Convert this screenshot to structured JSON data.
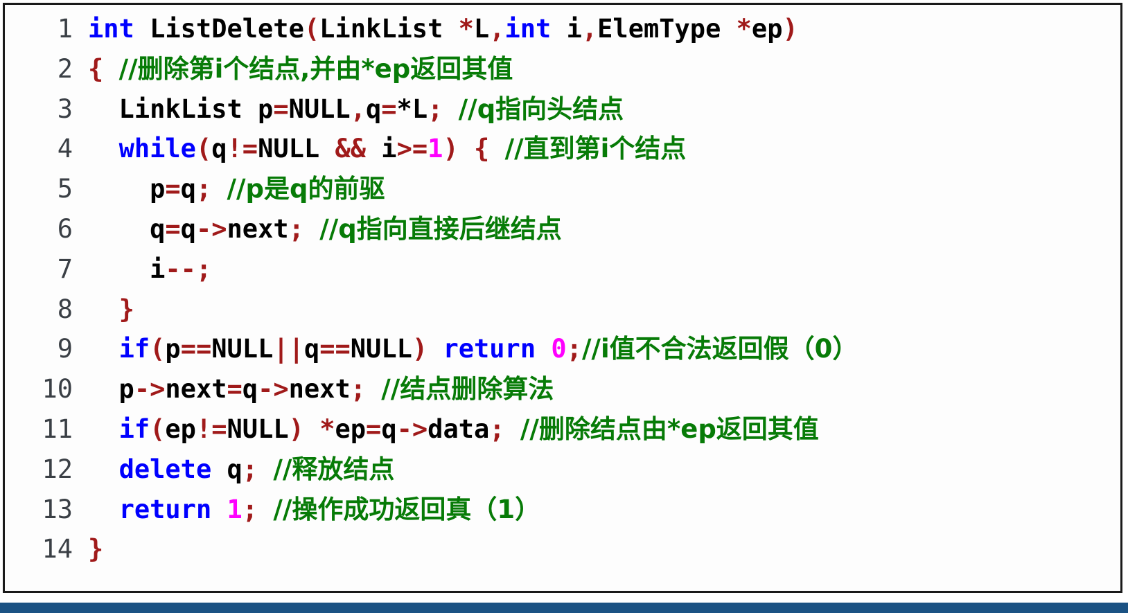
{
  "window": {
    "title": "code-listing",
    "border_color": "#1a1a1a",
    "background": "#fdfdfd",
    "bottom_bar_color": "#1b5283"
  },
  "syntax_colors": {
    "keyword": "#0000ff",
    "identifier": "#000000",
    "punctuation": "#a01a1a",
    "number": "#ff00ff",
    "comment": "#077b07",
    "line_number": "#3a3f45"
  },
  "code": {
    "language": "C++",
    "function_name": "ListDelete",
    "line_count": 14,
    "lines": [
      {
        "number": "1",
        "indent": "",
        "text": "int ListDelete(LinkList *L,int i,ElemType *ep)",
        "tokens": [
          {
            "t": "int",
            "c": "kw"
          },
          {
            "t": " ListDelete",
            "c": "plain"
          },
          {
            "t": "(",
            "c": "punct"
          },
          {
            "t": "LinkList ",
            "c": "plain"
          },
          {
            "t": "*",
            "c": "punct"
          },
          {
            "t": "L",
            "c": "plain"
          },
          {
            "t": ",",
            "c": "punct"
          },
          {
            "t": "int",
            "c": "kw"
          },
          {
            "t": " i",
            "c": "plain"
          },
          {
            "t": ",",
            "c": "punct"
          },
          {
            "t": "ElemType ",
            "c": "plain"
          },
          {
            "t": "*",
            "c": "punct"
          },
          {
            "t": "ep",
            "c": "plain"
          },
          {
            "t": ")",
            "c": "punct"
          }
        ]
      },
      {
        "number": "2",
        "indent": "",
        "text": "{ //删除第i个结点,并由*ep返回其值",
        "tokens": [
          {
            "t": "{",
            "c": "punct"
          },
          {
            "t": " ",
            "c": "plain"
          },
          {
            "t": "//删除第i个结点,并由*ep返回其值",
            "c": "comment"
          }
        ]
      },
      {
        "number": "3",
        "indent": "  ",
        "text": "  LinkList p=NULL,q=*L; //q指向头结点",
        "tokens": [
          {
            "t": "  LinkList p",
            "c": "plain"
          },
          {
            "t": "=",
            "c": "punct"
          },
          {
            "t": "NULL",
            "c": "plain"
          },
          {
            "t": ",",
            "c": "punct"
          },
          {
            "t": "q",
            "c": "plain"
          },
          {
            "t": "=",
            "c": "punct"
          },
          {
            "t": "*",
            "c": "plain"
          },
          {
            "t": "L",
            "c": "plain"
          },
          {
            "t": ";",
            "c": "punct"
          },
          {
            "t": " ",
            "c": "plain"
          },
          {
            "t": "//q指向头结点",
            "c": "comment"
          }
        ]
      },
      {
        "number": "4",
        "indent": "  ",
        "text": "  while(q!=NULL && i>=1) { //直到第i个结点",
        "tokens": [
          {
            "t": "  ",
            "c": "plain"
          },
          {
            "t": "while",
            "c": "kw"
          },
          {
            "t": "(",
            "c": "punct"
          },
          {
            "t": "q",
            "c": "plain"
          },
          {
            "t": "!=",
            "c": "punct"
          },
          {
            "t": "NULL ",
            "c": "plain"
          },
          {
            "t": "&&",
            "c": "punct"
          },
          {
            "t": " i",
            "c": "plain"
          },
          {
            "t": ">=",
            "c": "punct"
          },
          {
            "t": "1",
            "c": "num"
          },
          {
            "t": ")",
            "c": "punct"
          },
          {
            "t": " ",
            "c": "plain"
          },
          {
            "t": "{",
            "c": "punct"
          },
          {
            "t": " ",
            "c": "plain"
          },
          {
            "t": "//直到第i个结点",
            "c": "comment"
          }
        ]
      },
      {
        "number": "5",
        "indent": "    ",
        "text": "    p=q; //p是q的前驱",
        "tokens": [
          {
            "t": "    p",
            "c": "plain"
          },
          {
            "t": "=",
            "c": "punct"
          },
          {
            "t": "q",
            "c": "plain"
          },
          {
            "t": ";",
            "c": "punct"
          },
          {
            "t": " ",
            "c": "plain"
          },
          {
            "t": "//p是q的前驱",
            "c": "comment"
          }
        ]
      },
      {
        "number": "6",
        "indent": "    ",
        "text": "    q=q->next; //q指向直接后继结点",
        "tokens": [
          {
            "t": "    q",
            "c": "plain"
          },
          {
            "t": "=",
            "c": "punct"
          },
          {
            "t": "q",
            "c": "plain"
          },
          {
            "t": "->",
            "c": "punct"
          },
          {
            "t": "next",
            "c": "plain"
          },
          {
            "t": ";",
            "c": "punct"
          },
          {
            "t": " ",
            "c": "plain"
          },
          {
            "t": "//q指向直接后继结点",
            "c": "comment"
          }
        ]
      },
      {
        "number": "7",
        "indent": "    ",
        "text": "    i--;",
        "tokens": [
          {
            "t": "    i",
            "c": "plain"
          },
          {
            "t": "--",
            "c": "punct"
          },
          {
            "t": ";",
            "c": "punct"
          }
        ]
      },
      {
        "number": "8",
        "indent": "  ",
        "text": "  }",
        "tokens": [
          {
            "t": "  ",
            "c": "plain"
          },
          {
            "t": "}",
            "c": "punct"
          }
        ]
      },
      {
        "number": "9",
        "indent": "  ",
        "text": "  if(p==NULL||q==NULL) return 0;//i值不合法返回假（0）",
        "tokens": [
          {
            "t": "  ",
            "c": "plain"
          },
          {
            "t": "if",
            "c": "kw"
          },
          {
            "t": "(",
            "c": "punct"
          },
          {
            "t": "p",
            "c": "plain"
          },
          {
            "t": "==",
            "c": "punct"
          },
          {
            "t": "NULL",
            "c": "plain"
          },
          {
            "t": "||",
            "c": "punct"
          },
          {
            "t": "q",
            "c": "plain"
          },
          {
            "t": "==",
            "c": "punct"
          },
          {
            "t": "NULL",
            "c": "plain"
          },
          {
            "t": ")",
            "c": "punct"
          },
          {
            "t": " ",
            "c": "plain"
          },
          {
            "t": "return",
            "c": "kw"
          },
          {
            "t": " ",
            "c": "plain"
          },
          {
            "t": "0",
            "c": "num"
          },
          {
            "t": ";",
            "c": "punct"
          },
          {
            "t": "//i值不合法返回假（0）",
            "c": "comment"
          }
        ]
      },
      {
        "number": "10",
        "indent": "  ",
        "text": "  p->next=q->next; //结点删除算法",
        "tokens": [
          {
            "t": "  p",
            "c": "plain"
          },
          {
            "t": "->",
            "c": "punct"
          },
          {
            "t": "next",
            "c": "plain"
          },
          {
            "t": "=",
            "c": "punct"
          },
          {
            "t": "q",
            "c": "plain"
          },
          {
            "t": "->",
            "c": "punct"
          },
          {
            "t": "next",
            "c": "plain"
          },
          {
            "t": ";",
            "c": "punct"
          },
          {
            "t": " ",
            "c": "plain"
          },
          {
            "t": "//结点删除算法",
            "c": "comment"
          }
        ]
      },
      {
        "number": "11",
        "indent": "  ",
        "text": "  if(ep!=NULL) *ep=q->data; //删除结点由*ep返回其值",
        "tokens": [
          {
            "t": "  ",
            "c": "plain"
          },
          {
            "t": "if",
            "c": "kw"
          },
          {
            "t": "(",
            "c": "punct"
          },
          {
            "t": "ep",
            "c": "plain"
          },
          {
            "t": "!=",
            "c": "punct"
          },
          {
            "t": "NULL",
            "c": "plain"
          },
          {
            "t": ")",
            "c": "punct"
          },
          {
            "t": " ",
            "c": "plain"
          },
          {
            "t": "*",
            "c": "punct"
          },
          {
            "t": "ep",
            "c": "plain"
          },
          {
            "t": "=",
            "c": "punct"
          },
          {
            "t": "q",
            "c": "plain"
          },
          {
            "t": "->",
            "c": "punct"
          },
          {
            "t": "data",
            "c": "plain"
          },
          {
            "t": ";",
            "c": "punct"
          },
          {
            "t": " ",
            "c": "plain"
          },
          {
            "t": "//删除结点由*ep返回其值",
            "c": "comment"
          }
        ]
      },
      {
        "number": "12",
        "indent": "  ",
        "text": "  delete q; //释放结点",
        "tokens": [
          {
            "t": "  ",
            "c": "plain"
          },
          {
            "t": "delete",
            "c": "kw"
          },
          {
            "t": " q",
            "c": "plain"
          },
          {
            "t": ";",
            "c": "punct"
          },
          {
            "t": " ",
            "c": "plain"
          },
          {
            "t": "//释放结点",
            "c": "comment"
          }
        ]
      },
      {
        "number": "13",
        "indent": "  ",
        "text": "  return 1; //操作成功返回真（1）",
        "tokens": [
          {
            "t": "  ",
            "c": "plain"
          },
          {
            "t": "return",
            "c": "kw"
          },
          {
            "t": " ",
            "c": "plain"
          },
          {
            "t": "1",
            "c": "num"
          },
          {
            "t": ";",
            "c": "punct"
          },
          {
            "t": " ",
            "c": "plain"
          },
          {
            "t": "//操作成功返回真（1）",
            "c": "comment"
          }
        ]
      },
      {
        "number": "14",
        "indent": "",
        "text": "}",
        "tokens": [
          {
            "t": "}",
            "c": "punct"
          }
        ]
      }
    ]
  }
}
